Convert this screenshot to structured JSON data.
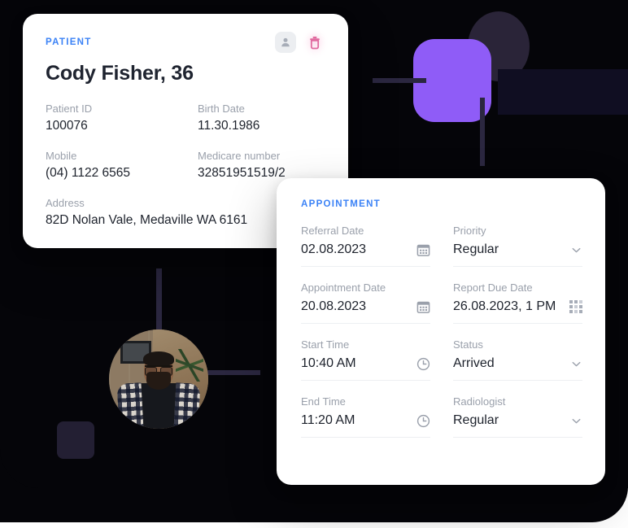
{
  "patient_card": {
    "eyebrow": "PATIENT",
    "name": "Cody Fisher, 36",
    "actions": [
      {
        "name": "person-icon",
        "label": "Patient profile"
      },
      {
        "name": "trash-icon",
        "label": "Delete patient"
      }
    ],
    "fields": [
      {
        "label": "Patient ID",
        "value": "100076"
      },
      {
        "label": "Birth Date",
        "value": "11.30.1986"
      },
      {
        "label": "Mobile",
        "value": "(04) 1122 6565"
      },
      {
        "label": "Medicare number",
        "value": "32851951519/2"
      },
      {
        "label": "Address",
        "value": "82D Nolan Vale, Medaville WA 6161"
      }
    ]
  },
  "appointment_card": {
    "eyebrow": "APPOINTMENT",
    "fields": [
      {
        "label": "Referral Date",
        "value": "02.08.2023",
        "trail": "calendar-icon"
      },
      {
        "label": "Priority",
        "value": "Regular",
        "trail": "chevron-down-icon"
      },
      {
        "label": "Appointment Date",
        "value": "20.08.2023",
        "trail": "calendar-icon"
      },
      {
        "label": "Report Due Date",
        "value": "26.08.2023, 1 PM",
        "trail": "grid-icon"
      },
      {
        "label": "Start Time",
        "value": "10:40 AM",
        "trail": "clock-icon"
      },
      {
        "label": "Status",
        "value": "Arrived",
        "trail": "chevron-down-icon"
      },
      {
        "label": "End Time",
        "value": "11:20 AM",
        "trail": "clock-icon"
      },
      {
        "label": "Radiologist",
        "value": "Regular",
        "trail": "chevron-down-icon"
      }
    ]
  },
  "colors": {
    "accent_blue": "#3b82f6",
    "accent_purple": "#8f5cf7",
    "accent_pink": "#ec4899",
    "backdrop": "#050509",
    "navy_shape": "#2a2438",
    "label_grey": "#9aa0ab",
    "value_dark": "#1d222c"
  }
}
